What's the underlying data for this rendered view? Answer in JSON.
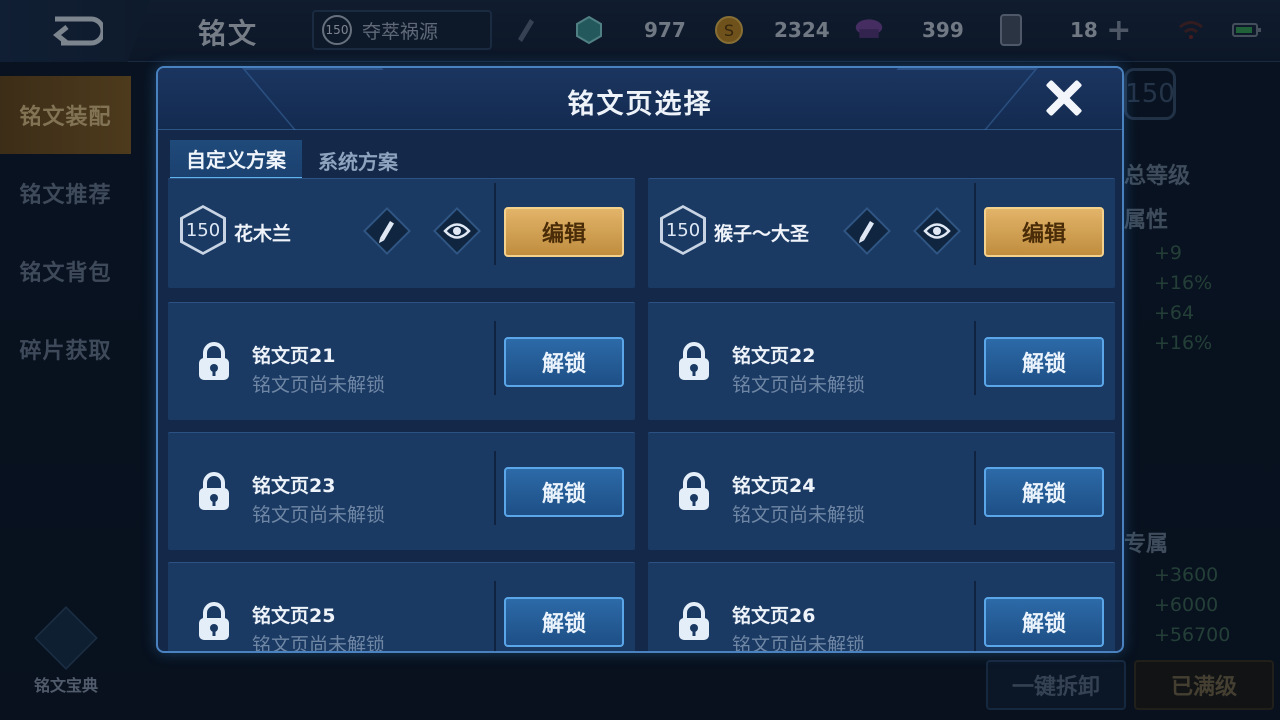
{
  "topbar": {
    "title": "铭文",
    "current_page": {
      "level": "150",
      "name": "夺萃祸源"
    },
    "currencies": [
      {
        "icon": "crystal-icon",
        "value": "977"
      },
      {
        "icon": "gold-coin-icon",
        "value": "2324"
      },
      {
        "icon": "purple-crystal-icon",
        "value": "399"
      },
      {
        "icon": "card-icon",
        "value": "18"
      }
    ]
  },
  "side_menu": {
    "items": [
      {
        "label": "铭文装配",
        "active": true
      },
      {
        "label": "铭文推荐",
        "active": false
      },
      {
        "label": "铭文背包",
        "active": false
      },
      {
        "label": "碎片获取",
        "active": false
      }
    ],
    "codex_label": "铭文宝典"
  },
  "right_panel": {
    "level": "150",
    "title": "总等级",
    "attr_header": "属性",
    "stats": [
      "+9",
      "+16%",
      "+64",
      "+16%"
    ],
    "exclusive_header": "专属",
    "exclusive_stats": [
      "+3600",
      "+6000",
      "+56700"
    ],
    "unequip_label": "一键拆卸",
    "maxed_label": "已满级"
  },
  "dialog": {
    "title": "铭文页选择",
    "tabs": [
      {
        "label": "自定义方案",
        "active": true
      },
      {
        "label": "系统方案",
        "active": false
      }
    ],
    "owned_pages": [
      {
        "level": "150",
        "name": "花木兰",
        "button": "编辑"
      },
      {
        "level": "150",
        "name": "猴子～大圣",
        "button": "编辑"
      }
    ],
    "locked_pages": [
      {
        "name": "铭文页21",
        "status": "铭文页尚未解锁",
        "button": "解锁"
      },
      {
        "name": "铭文页22",
        "status": "铭文页尚未解锁",
        "button": "解锁"
      },
      {
        "name": "铭文页23",
        "status": "铭文页尚未解锁",
        "button": "解锁"
      },
      {
        "name": "铭文页24",
        "status": "铭文页尚未解锁",
        "button": "解锁"
      },
      {
        "name": "铭文页25",
        "status": "铭文页尚未解锁",
        "button": "解锁"
      },
      {
        "name": "铭文页26",
        "status": "铭文页尚未解锁",
        "button": "解锁"
      }
    ]
  },
  "colors": {
    "accent_gold": "#e2b469",
    "accent_blue": "#2c6aa8",
    "panel_bg": "#1a3a63"
  }
}
